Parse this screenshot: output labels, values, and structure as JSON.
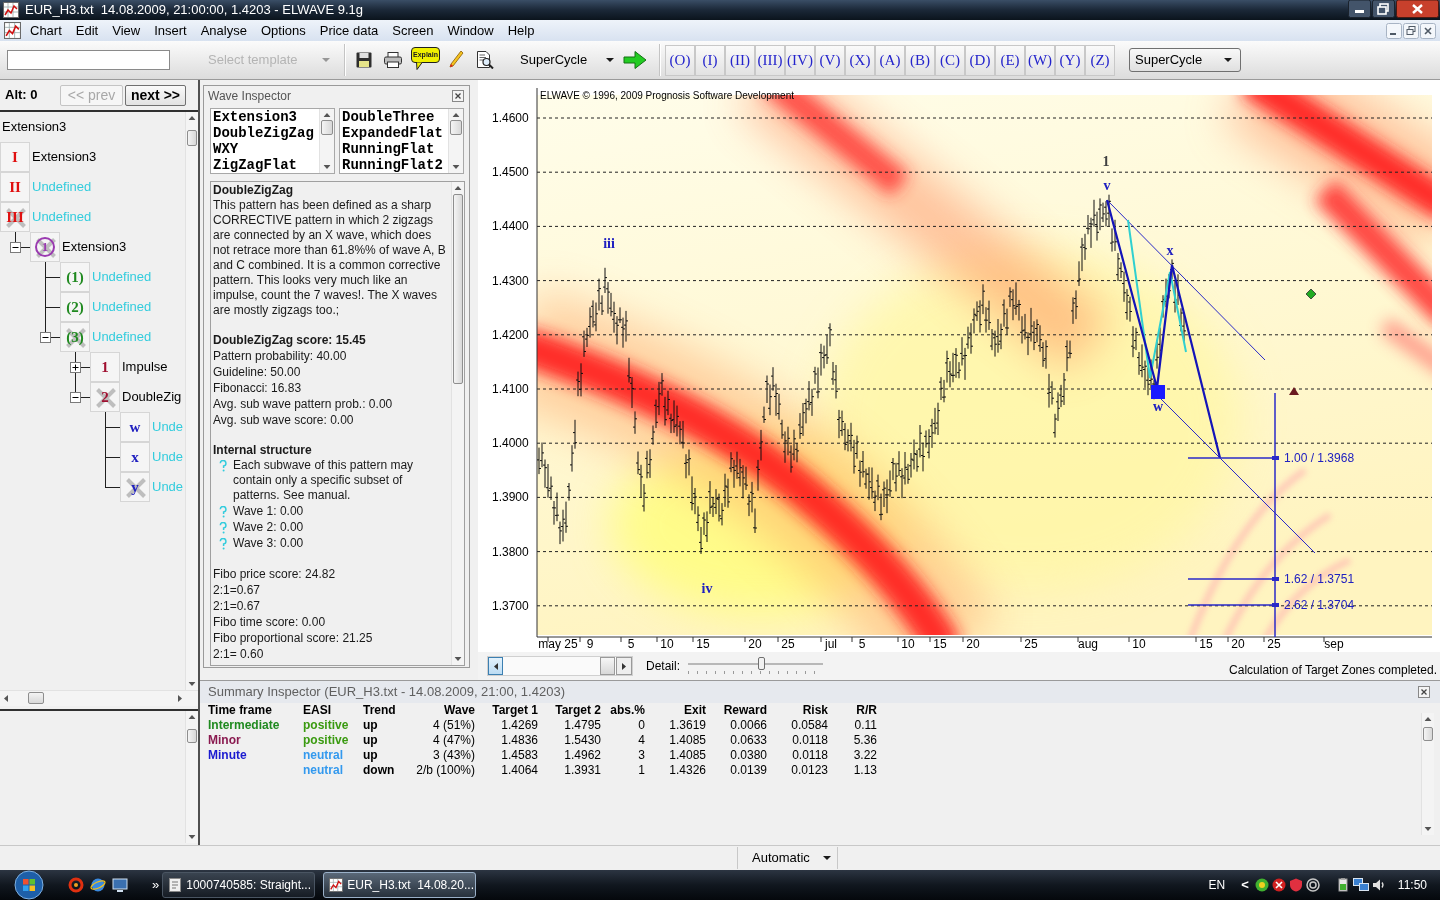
{
  "window": {
    "title": "EUR_H3.txt  14.08.2009, 21:00:00, 1.4203 - ELWAVE 9.1g"
  },
  "menu": [
    "Chart",
    "Edit",
    "View",
    "Insert",
    "Analyse",
    "Options",
    "Price data",
    "Screen",
    "Window",
    "Help"
  ],
  "toolbar": {
    "template": {
      "placeholder": "Select template",
      "disabled": true
    },
    "explain_label": "Explain",
    "degree": "SuperCycle",
    "wave_buttons": [
      "(O)",
      "(I)",
      "(II)",
      "(III)",
      "(IV)",
      "(V)",
      "(X)",
      "(A)",
      "(B)",
      "(C)",
      "(D)",
      "(E)",
      "(W)",
      "(Y)",
      "(Z)"
    ],
    "degree_combo": "SuperCycle"
  },
  "alternatives": {
    "label": "Alt: 0",
    "prev": {
      "label": "<< prev",
      "disabled": true
    },
    "next": {
      "label": "next >>",
      "disabled": false
    }
  },
  "wave_tree": {
    "root": "Extension3",
    "items": [
      {
        "mark": "I",
        "color": "#e01010",
        "label": "Extension3",
        "defined": true,
        "crossed": false
      },
      {
        "mark": "II",
        "color": "#e01010",
        "label": "Undefined",
        "defined": false,
        "crossed": false
      },
      {
        "mark": "III",
        "color": "#e01010",
        "label": "Undefined",
        "defined": false,
        "crossed": true,
        "children": [
          {
            "mark": "1",
            "color": "#9a3ab0",
            "circled": true,
            "label": "Extension3",
            "defined": true,
            "crossed": true,
            "expanded": true,
            "children": [
              {
                "mark": "(1)",
                "color": "#208a20",
                "label": "Undefined",
                "defined": false,
                "crossed": false
              },
              {
                "mark": "(2)",
                "color": "#208a20",
                "label": "Undefined",
                "defined": false,
                "crossed": false
              },
              {
                "mark": "(3)",
                "color": "#208a20",
                "label": "Undefined",
                "defined": false,
                "crossed": true,
                "expanded": true,
                "children": [
                  {
                    "mark": "1",
                    "color": "#a01030",
                    "label": "Impulse",
                    "defined": true,
                    "crossed": false,
                    "expanded": false
                  },
                  {
                    "mark": "2",
                    "color": "#a01030",
                    "label": "DoubleZig",
                    "defined": true,
                    "crossed": true,
                    "expanded": true,
                    "children": [
                      {
                        "mark": "w",
                        "color": "#2020c0",
                        "label": "Unde",
                        "defined": false,
                        "crossed": false
                      },
                      {
                        "mark": "x",
                        "color": "#2020c0",
                        "label": "Unde",
                        "defined": false,
                        "crossed": false
                      },
                      {
                        "mark": "y",
                        "color": "#2020c0",
                        "label": "Unde",
                        "defined": false,
                        "crossed": true
                      }
                    ]
                  }
                ]
              }
            ]
          }
        ]
      }
    ]
  },
  "wave_inspector": {
    "title": "Wave Inspector",
    "patterns_left": [
      "Extension3",
      "DoubleZigZag",
      "WXY",
      "ZigZagFlat"
    ],
    "patterns_right": [
      "DoubleThree",
      "ExpandedFlat",
      "RunningFlat",
      "RunningFlat2"
    ],
    "details": [
      {
        "kind": "heading",
        "text": "DoubleZigZag"
      },
      {
        "kind": "paragraph",
        "text": "This pattern has been defined as a sharp CORRECTIVE pattern in which 2 zigzags are connected by an X wave, which does not retrace more than 61.8%% of wave A, B and C combined. It is a common corrective pattern. This looks very much like an impulse, count the 7 waves!. The X waves are mostly zigzags too.;"
      },
      {
        "kind": "gap"
      },
      {
        "kind": "heading",
        "text": "DoubleZigZag score: 15.45"
      },
      {
        "kind": "text",
        "text": "Pattern probability: 40.00"
      },
      {
        "kind": "text",
        "text": "Guideline: 50.00"
      },
      {
        "kind": "text",
        "text": "Fibonacci: 16.83"
      },
      {
        "kind": "text",
        "text": "Avg. sub wave pattern prob.: 0.00"
      },
      {
        "kind": "text",
        "text": "Avg. sub wave score: 0.00"
      },
      {
        "kind": "gap"
      },
      {
        "kind": "heading",
        "text": "Internal structure"
      },
      {
        "kind": "bullet",
        "text": "Each subwave of this pattern may contain only a specific subset of patterns. See manual."
      },
      {
        "kind": "bullet",
        "text": "Wave 1: 0.00"
      },
      {
        "kind": "bullet",
        "text": "Wave 2: 0.00"
      },
      {
        "kind": "bullet",
        "text": "Wave 3: 0.00"
      },
      {
        "kind": "gap"
      },
      {
        "kind": "text",
        "text": "Fibo price score: 24.82"
      },
      {
        "kind": "text",
        "text": "2:1=0.67"
      },
      {
        "kind": "text",
        "text": "2:1=0.67"
      },
      {
        "kind": "text",
        "text": "Fibo time score: 0.00"
      },
      {
        "kind": "text",
        "text": "Fibo proportional score: 21.25"
      },
      {
        "kind": "text",
        "text": "2:1= 0.60"
      }
    ]
  },
  "chart": {
    "credit": "ELWAVE © 1996, 2009 Prognosis Software Development",
    "y_labels": [
      "1.4600",
      "1.4500",
      "1.4400",
      "1.4300",
      "1.4200",
      "1.4100",
      "1.4000",
      "1.3900",
      "1.3800",
      "1.3700"
    ],
    "x_labels": [
      "may 25",
      "9",
      "5",
      "10",
      "15",
      "20",
      "25",
      "jul",
      "5",
      "10",
      "15",
      "20",
      "25",
      "aug",
      "10",
      "15",
      "20",
      "25",
      "sep"
    ],
    "wave_labels": [
      {
        "text": "iii",
        "color": "#2020c0"
      },
      {
        "text": "iv",
        "color": "#2020c0"
      },
      {
        "text": "1",
        "color": "#404040"
      },
      {
        "text": "v",
        "color": "#2020c0"
      },
      {
        "text": "x",
        "color": "#2020c0"
      },
      {
        "text": "w",
        "color": "#2020c0"
      }
    ],
    "targets": [
      "1.00 / 1.3968",
      "1.62 / 1.3751",
      "2.62 / 1.3704"
    ],
    "detail": {
      "label": "Detail:",
      "level": 0.54
    },
    "status": "Calculation of Target Zones completed."
  },
  "summary": {
    "title": "Summary Inspector (EUR_H3.txt - 14.08.2009, 21:00, 1.4203)",
    "columns": [
      "Time frame",
      "EASI",
      "Trend",
      "Wave",
      "Target 1",
      "Target 2",
      "abs.%",
      "Exit",
      "Reward",
      "Risk",
      "R/R"
    ],
    "rows": [
      {
        "time_frame": {
          "text": "Intermediate",
          "color": "#1f8a1f"
        },
        "easi": {
          "text": "positive",
          "color": "#3a9a10"
        },
        "values": [
          "up",
          "4 (51%)",
          "1.4269",
          "1.4795",
          "0",
          "1.3619",
          "0.0066",
          "0.0584",
          "0.11"
        ]
      },
      {
        "time_frame": {
          "text": "Minor",
          "color": "#8a1a50"
        },
        "easi": {
          "text": "positive",
          "color": "#3a9a10"
        },
        "values": [
          "up",
          "4 (47%)",
          "1.4836",
          "1.5430",
          "4",
          "1.4085",
          "0.0633",
          "0.0118",
          "5.36"
        ]
      },
      {
        "time_frame": {
          "text": "Minute",
          "color": "#1a1ad0"
        },
        "easi": {
          "text": "neutral",
          "color": "#3399ee"
        },
        "values": [
          "up",
          "3 (43%)",
          "1.4583",
          "1.4962",
          "3",
          "1.4085",
          "0.0380",
          "0.0118",
          "3.22"
        ]
      },
      {
        "easi": {
          "text": "neutral",
          "color": "#3399ee"
        },
        "values": [
          "down",
          "2/b (100%)",
          "1.4064",
          "1.3931",
          "1",
          "1.4326",
          "0.0139",
          "0.0123",
          "1.13"
        ]
      }
    ]
  },
  "status_bar": {
    "mode": "Automatic"
  },
  "taskbar": {
    "overflow": "»",
    "tasks": [
      {
        "label": "1000740585: Straight...",
        "selected": false
      },
      {
        "label": "EUR_H3.txt  14.08.20...",
        "selected": true
      }
    ],
    "language": "EN",
    "tray_toggle": "<",
    "clock": "11:50"
  }
}
